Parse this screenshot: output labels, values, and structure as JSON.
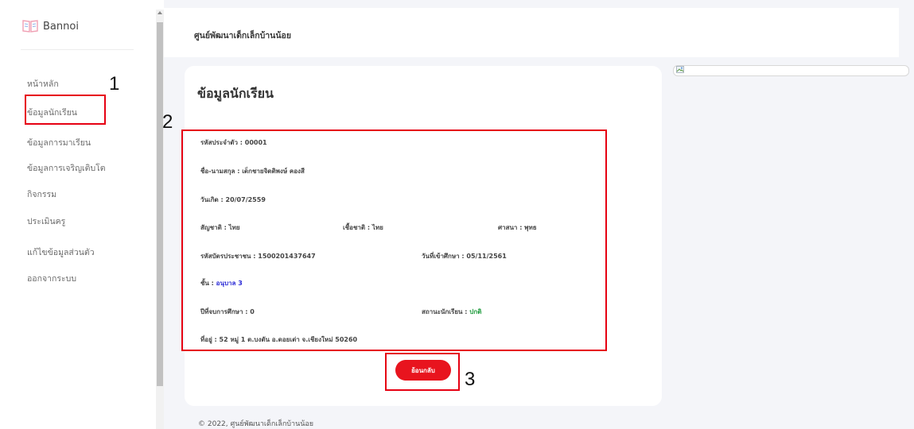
{
  "brand": {
    "name": "Bannoi",
    "icon": "open-book-icon"
  },
  "header": {
    "title": "ศูนย์พัฒนาเด็กเล็กบ้านน้อย"
  },
  "sidebar": {
    "items": [
      {
        "label": "หน้าหลัก"
      },
      {
        "label": "ข้อมูลนักเรียน"
      },
      {
        "label": "ข้อมูลการมาเรียน"
      },
      {
        "label": "ข้อมูลการเจริญเติบโต"
      },
      {
        "label": "กิจกรรม"
      },
      {
        "label": "ประเมินครู"
      },
      {
        "label": "แก้ไขข้อมูลส่วนตัว"
      },
      {
        "label": "ออกจากระบบ"
      }
    ]
  },
  "student": {
    "card_title": "ข้อมูลนักเรียน",
    "id": "รหัสประจำตัว : 00001",
    "name": "ชื่อ-นามสกุล : เด็กชายจิตติพงษ์ คองสี",
    "birthdate": "วันเกิด : 20/07/2559",
    "nationality": "สัญชาติ : ไทย",
    "ethnicity": "เชื้อชาติ : ไทย",
    "religion": "ศาสนา : พุทธ",
    "citizen_id": "รหัสบัตรประชาชน : 1500201437647",
    "enroll_date": "วันที่เข้าศึกษา : 05/11/2561",
    "level_label": "ชั้น : ",
    "level_value": "อนุบาล 3",
    "graduation_year": "ปีที่จบการศึกษา : 0",
    "status_label": "สถานะนักเรียน : ",
    "status_value": "ปกติ",
    "address": "ที่อยู่ : 52 หมู่ 1 ต.บงตัน อ.ดอยเต่า จ.เชียงใหม่ 50260",
    "back_button": "ย้อนกลับ"
  },
  "footer": {
    "text": "© 2022, ศูนย์พัฒนาเด็กเล็กบ้านน้อย"
  },
  "annotations": [
    "1",
    "2",
    "3"
  ],
  "colors": {
    "accent": "#e8141e",
    "level": "#2b2bd6",
    "status": "#1b9a3a",
    "annotation": "#e60012"
  }
}
